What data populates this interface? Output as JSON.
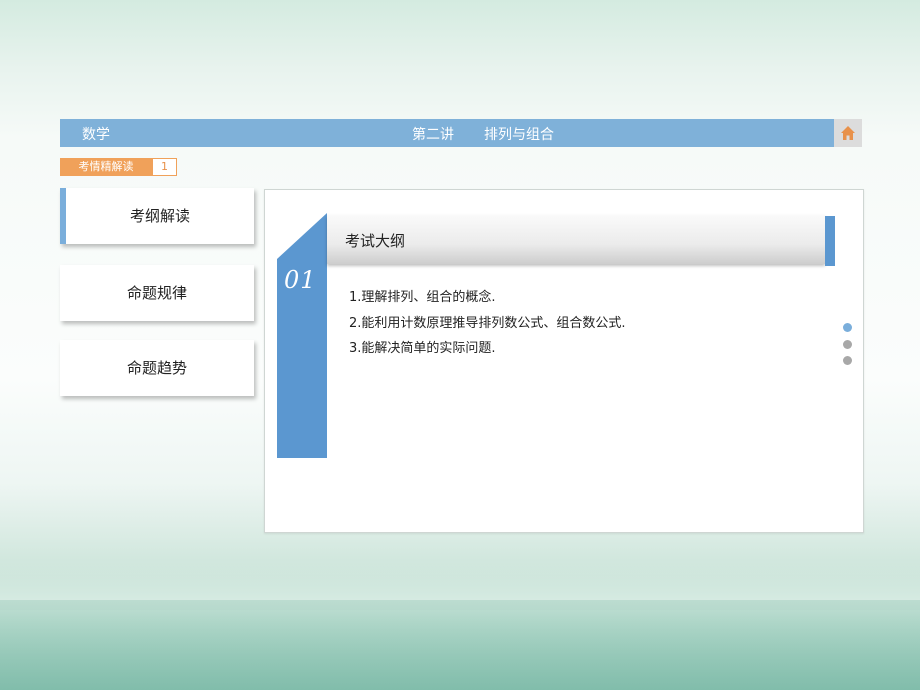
{
  "header": {
    "subject": "数学",
    "lecture": "第二讲",
    "topic": "排列与组合",
    "home_icon": "home-icon",
    "bar_color": "#7fb1d9"
  },
  "tag": {
    "label": "考情精解读",
    "page": "1",
    "color": "#f0a15a"
  },
  "sidebar": {
    "items": [
      {
        "label": "考纲解读",
        "active": true
      },
      {
        "label": "命题规律",
        "active": false
      },
      {
        "label": "命题趋势",
        "active": false
      }
    ]
  },
  "main": {
    "section_number": "01",
    "section_title": "考试大纲",
    "accent_color": "#5b97d0",
    "lines": [
      "1.理解排列、组合的概念.",
      "2.能利用计数原理推导排列数公式、组合数公式.",
      "3.能解决简单的实际问题."
    ]
  },
  "pager": {
    "pages": 3,
    "active_index": 0
  }
}
